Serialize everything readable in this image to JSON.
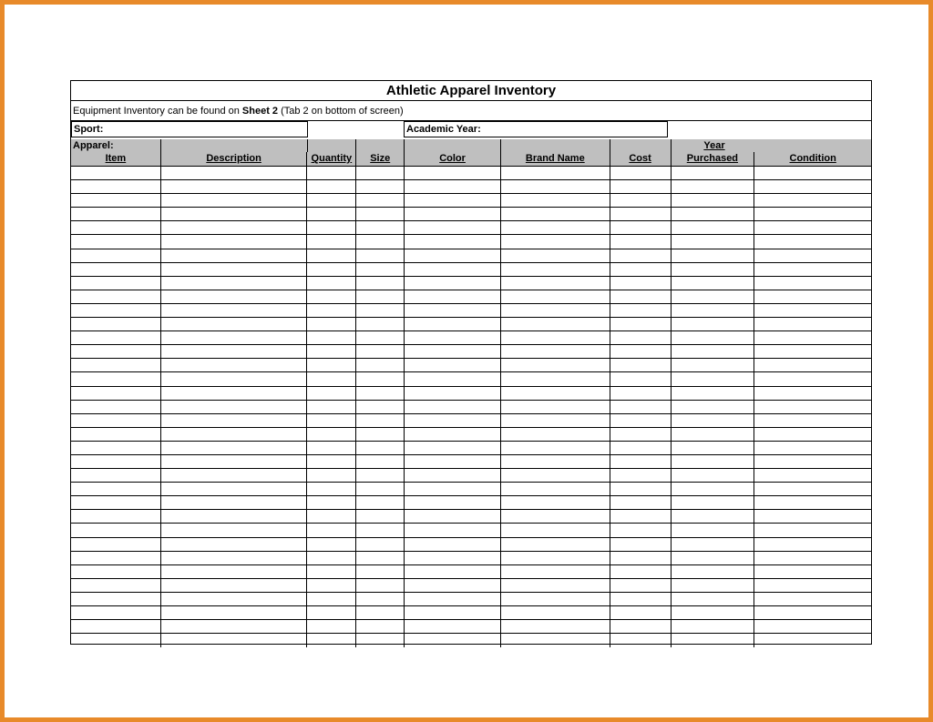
{
  "title": "Athletic Apparel Inventory",
  "note_prefix": "Equipment Inventory can be found on ",
  "note_bold": "Sheet 2",
  "note_suffix": " (Tab 2 on bottom of screen)",
  "fields": {
    "sport_label": "Sport:",
    "sport_value": "",
    "year_label": "Academic Year:",
    "year_value": ""
  },
  "section_label": "Apparel:",
  "columns": [
    "Item",
    "Description",
    "Quantity",
    "Size",
    "Color",
    "Brand Name",
    "Cost",
    "Year",
    "Purchased",
    "Condition"
  ],
  "column_headers": {
    "item": "Item",
    "description": "Description",
    "quantity": "Quantity",
    "size": "Size",
    "color": "Color",
    "brand": "Brand Name",
    "cost": "Cost",
    "year_top": "Year",
    "year_bottom": "Purchased",
    "condition": "Condition"
  },
  "row_count": 35,
  "rows": []
}
